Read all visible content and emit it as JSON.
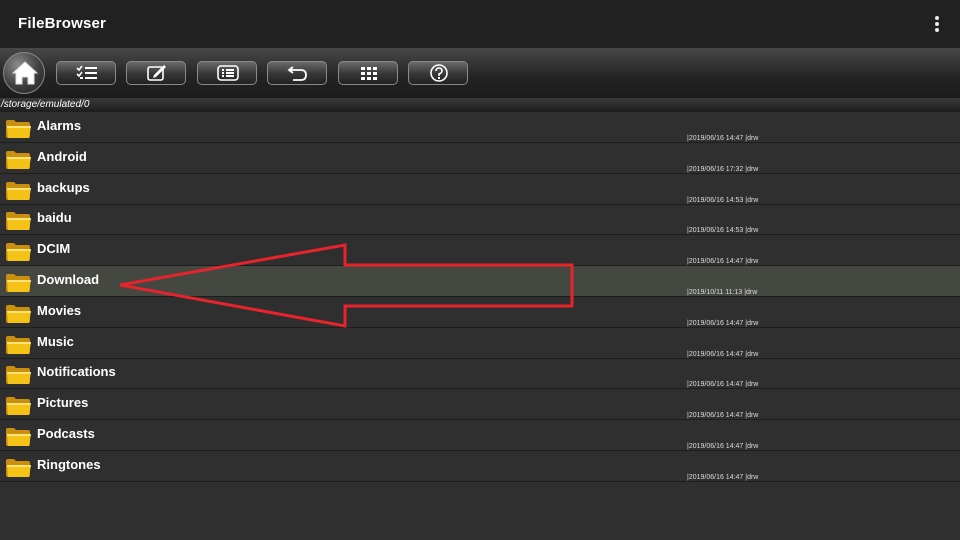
{
  "app": {
    "title": "FileBrowser"
  },
  "menu": {
    "icon": "more-vert-icon"
  },
  "toolbar": {
    "buttons": [
      {
        "name": "home-button",
        "icon": "home-icon"
      },
      {
        "name": "multi-select-button",
        "icon": "checklist-icon"
      },
      {
        "name": "edit-button",
        "icon": "edit-icon"
      },
      {
        "name": "list-view-button",
        "icon": "list-icon"
      },
      {
        "name": "back-button",
        "icon": "undo-icon"
      },
      {
        "name": "grid-view-button",
        "icon": "grid-icon"
      },
      {
        "name": "help-button",
        "icon": "help-icon"
      }
    ]
  },
  "path": "/storage/emulated/0",
  "files": [
    {
      "name": "Alarms",
      "meta": "|2019/06/16 14:47 |drw"
    },
    {
      "name": "Android",
      "meta": "|2019/06/16 17:32 |drw"
    },
    {
      "name": "backups",
      "meta": "|2019/06/16 14:53 |drw"
    },
    {
      "name": "baidu",
      "meta": "|2019/06/16 14:53 |drw"
    },
    {
      "name": "DCIM",
      "meta": "|2019/06/16 14:47 |drw"
    },
    {
      "name": "Download",
      "meta": "|2019/10/11 11:13 |drw",
      "selected": true
    },
    {
      "name": "Movies",
      "meta": "|2019/06/16 14:47 |drw"
    },
    {
      "name": "Music",
      "meta": "|2019/06/16 14:47 |drw"
    },
    {
      "name": "Notifications",
      "meta": "|2019/06/16 14:47 |drw"
    },
    {
      "name": "Pictures",
      "meta": "|2019/06/16 14:47 |drw"
    },
    {
      "name": "Podcasts",
      "meta": "|2019/06/16 14:47 |drw"
    },
    {
      "name": "Ringtones",
      "meta": "|2019/06/16 14:47 |drw"
    }
  ],
  "colors": {
    "folder": "#f5c218",
    "annotation_arrow": "#e8232b",
    "selected_row": "#454841"
  }
}
